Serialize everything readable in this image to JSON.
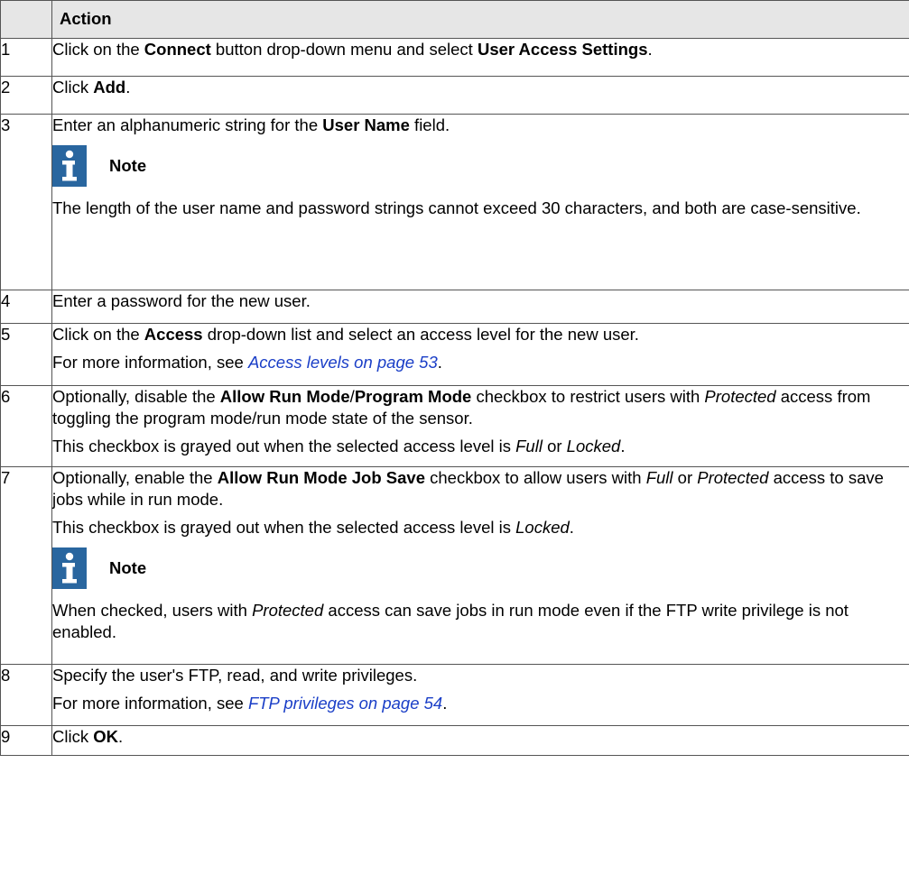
{
  "table": {
    "header": {
      "num": "",
      "action": "Action"
    },
    "rows": [
      {
        "num": "1",
        "parts": [
          "Click on the ",
          "Connect",
          " button drop-down menu and select ",
          "User Access Settings",
          "."
        ]
      },
      {
        "num": "2",
        "parts": [
          "Click ",
          "Add",
          "."
        ]
      },
      {
        "num": "3",
        "parts": [
          "Enter an alphanumeric string for the ",
          "User Name",
          " field."
        ],
        "note": {
          "title": "Note",
          "text": "The length of the user name and password strings cannot exceed 30 characters, and both are case-sensitive."
        }
      },
      {
        "num": "4",
        "text": "Enter a password for the new user."
      },
      {
        "num": "5",
        "parts": [
          "Click on the ",
          "Access",
          " drop-down list and select an access level for the new user."
        ],
        "more_prefix": "For more information, see ",
        "more_link": "Access levels on page 53",
        "more_suffix": "."
      },
      {
        "num": "6",
        "parts": [
          "Optionally, disable the ",
          "Allow Run Mode",
          "/",
          "Program Mode",
          " checkbox to restrict users with ",
          "Protected",
          " access from toggling the program mode/run mode state of the sensor."
        ],
        "parts2": [
          "This checkbox is grayed out when the selected access level is ",
          "Full",
          " or ",
          "Locked",
          "."
        ]
      },
      {
        "num": "7",
        "parts": [
          "Optionally, enable the ",
          "Allow Run Mode Job Save",
          " checkbox to allow users with ",
          "Full",
          " or ",
          "Protected",
          " access to save jobs while in run mode."
        ],
        "parts2": [
          "This checkbox is grayed out when the selected access level is ",
          "Locked",
          "."
        ],
        "note": {
          "title": "Note",
          "parts": [
            "When checked, users with ",
            "Protected",
            " access can save jobs in run mode even if the FTP write privilege is not enabled."
          ]
        }
      },
      {
        "num": "8",
        "text": "Specify the user's FTP, read, and write privileges.",
        "more_prefix": "For more information, see ",
        "more_link": "FTP privileges on page 54",
        "more_suffix": "."
      },
      {
        "num": "9",
        "parts": [
          "Click ",
          "OK",
          "."
        ]
      }
    ]
  },
  "icons": {
    "note_icon": "info-icon",
    "note_icon_color": "#29669f"
  },
  "colors": {
    "header_bg": "#e6e6e6",
    "link": "#1a3ec7",
    "border": "#555555"
  }
}
